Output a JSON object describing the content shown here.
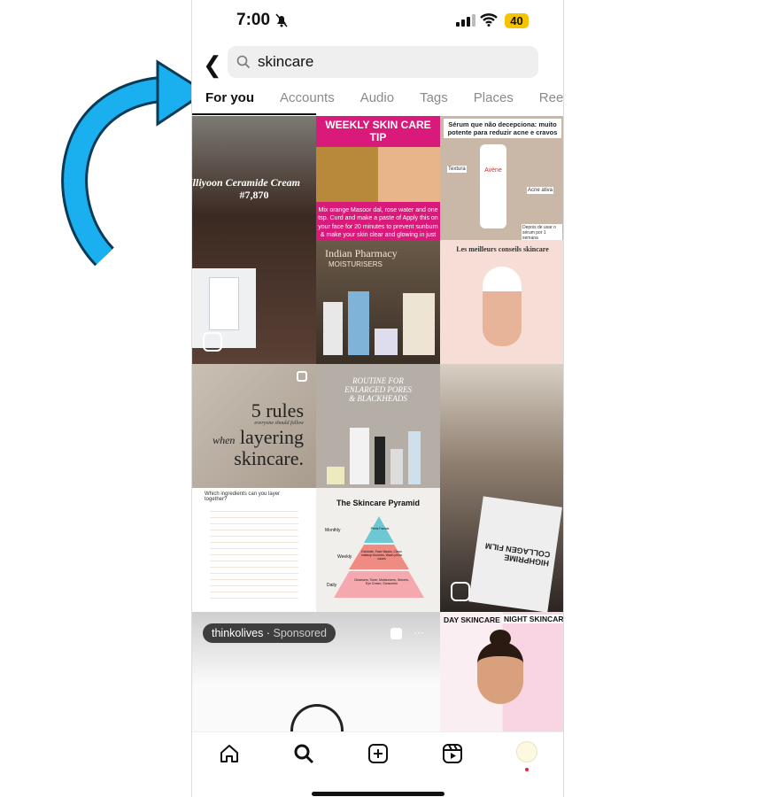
{
  "status_bar": {
    "time": "7:00",
    "battery": "40",
    "battery_color": "#f5c400"
  },
  "search": {
    "query": "skincare"
  },
  "tabs": [
    {
      "label": "For you",
      "active": true
    },
    {
      "label": "Accounts"
    },
    {
      "label": "Audio"
    },
    {
      "label": "Tags"
    },
    {
      "label": "Places"
    },
    {
      "label": "Reel"
    }
  ],
  "tiles": {
    "t1": {
      "caption": "Illiyoon Ceramide Cream",
      "number": "#7,870"
    },
    "t2": {
      "title": "WEEKLY SKIN CARE TIP",
      "body": "Mix orange  Masoor dal, rose water  and one tsp. Curd and make a paste of Apply this on your face for 20 minutes  to prevent sunburn & make your skin clear and glowing in just one use ."
    },
    "t3": {
      "title": "Sérum que não decepciona: muito potente para reduzir acne e cravos",
      "labels": [
        "Textura",
        "Acne ativa",
        "Depois de usar o sérum por 1 semana"
      ],
      "brand": "Avène"
    },
    "t4": {
      "title": "Indian Pharmacy",
      "subtitle": "MOISTURISERS"
    },
    "t5": {
      "title": "Les meilleurs conseils skincare"
    },
    "t6": {
      "big": "5 rules",
      "small": "everyone should follow",
      "when": "when",
      "layering": "layering",
      "skincare": "skincare."
    },
    "t7": {
      "title": "ROUTINE FOR ENLARGED PORES & BLACKHEADS"
    },
    "t9": {
      "title": "Which ingredients can you layer together?"
    },
    "t10": {
      "title": "The Skincare Pyramid",
      "levels": [
        {
          "label": "Monthly",
          "text": "Peels Facials"
        },
        {
          "label": "Weekly",
          "text": "Exfoliate, Face Masks, Clean makeup brushes, Wash pillow cases"
        },
        {
          "label": "Daily",
          "text": "Cleansers, Toner, Moisturizers, Serums, Eye Cream, Sunscreen"
        }
      ]
    },
    "t8": {
      "product": "HIGHPRIME COLLAGEN FILM"
    },
    "t11": {
      "account": "thinkolives",
      "sponsored": "Sponsored",
      "more": "···"
    },
    "t12": {
      "day": "DAY SKINCARE",
      "night": "NIGHT SKINCARE"
    }
  },
  "annotation": {
    "arrow_color": "#1ab0f0"
  }
}
